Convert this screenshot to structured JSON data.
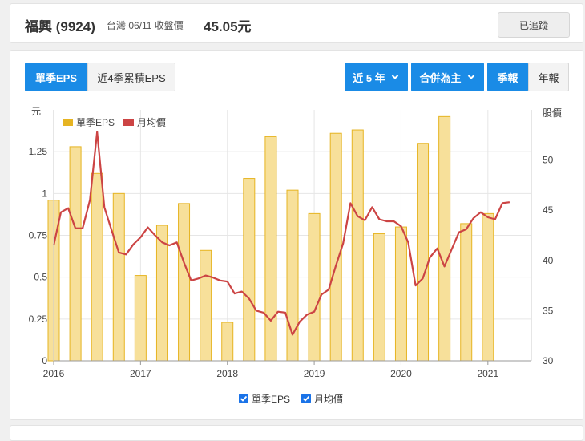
{
  "header": {
    "stock_name": "福興 (9924)",
    "quote_info": "台灣 06/11 收盤價",
    "price": "45.05元",
    "tracked_label": "已追蹤"
  },
  "toolbar": {
    "tab_quarter_eps": "單季EPS",
    "tab_cum4_eps": "近4季累積EPS",
    "range_label": "近 5 年",
    "consolidation_label": "合併為主",
    "quarterly_label": "季報",
    "annual_label": "年報"
  },
  "legend": {
    "eps_label": "單季EPS",
    "price_label": "月均價"
  },
  "colors": {
    "accent": "#1a8be6",
    "bar_fill": "#f7e09a",
    "bar_stroke": "#e6b422",
    "line": "#cc4444",
    "grid": "#e6e6e6"
  },
  "chart_data": {
    "type": "bar",
    "y_left_label": "元",
    "y_right_label": "股價",
    "y_left_range": [
      0,
      1.5
    ],
    "y_left_ticks": [
      "0",
      "0.25",
      "0.5",
      "0.75",
      "1",
      "1.25"
    ],
    "y_right_range": [
      30,
      55
    ],
    "y_right_ticks": [
      "30",
      "35",
      "40",
      "45",
      "50"
    ],
    "x_range": [
      2016.0,
      2021.5
    ],
    "x_ticks": [
      "2016",
      "2017",
      "2018",
      "2019",
      "2020",
      "2021"
    ],
    "grid": true,
    "legend_position": "top-left",
    "series": [
      {
        "name": "單季EPS",
        "type": "bar",
        "quarters": [
          "2016Q1",
          "2016Q2",
          "2016Q3",
          "2016Q4",
          "2017Q1",
          "2017Q2",
          "2017Q3",
          "2017Q4",
          "2018Q1",
          "2018Q2",
          "2018Q3",
          "2018Q4",
          "2019Q1",
          "2019Q2",
          "2019Q3",
          "2019Q4",
          "2020Q1",
          "2020Q2",
          "2020Q3",
          "2020Q4",
          "2021Q1"
        ],
        "x": [
          2016.0,
          2016.25,
          2016.5,
          2016.75,
          2017.0,
          2017.25,
          2017.5,
          2017.75,
          2018.0,
          2018.25,
          2018.5,
          2018.75,
          2019.0,
          2019.25,
          2019.5,
          2019.75,
          2020.0,
          2020.25,
          2020.5,
          2020.75,
          2021.0
        ],
        "values": [
          0.96,
          1.28,
          1.12,
          1.0,
          0.51,
          0.81,
          0.94,
          0.66,
          0.23,
          1.09,
          1.34,
          1.02,
          0.88,
          1.36,
          1.38,
          0.76,
          0.8,
          1.3,
          1.46,
          0.82,
          0.88
        ]
      },
      {
        "name": "月均價",
        "type": "line",
        "x": [
          2016.0,
          2016.083,
          2016.167,
          2016.25,
          2016.333,
          2016.417,
          2016.5,
          2016.583,
          2016.667,
          2016.75,
          2016.833,
          2016.917,
          2017.0,
          2017.083,
          2017.167,
          2017.25,
          2017.333,
          2017.417,
          2017.5,
          2017.583,
          2017.667,
          2017.75,
          2017.833,
          2017.917,
          2018.0,
          2018.083,
          2018.167,
          2018.25,
          2018.333,
          2018.417,
          2018.5,
          2018.583,
          2018.667,
          2018.75,
          2018.833,
          2018.917,
          2019.0,
          2019.083,
          2019.167,
          2019.25,
          2019.333,
          2019.417,
          2019.5,
          2019.583,
          2019.667,
          2019.75,
          2019.833,
          2019.917,
          2020.0,
          2020.083,
          2020.167,
          2020.25,
          2020.333,
          2020.417,
          2020.5,
          2020.583,
          2020.667,
          2020.75,
          2020.833,
          2020.917,
          2021.0,
          2021.083,
          2021.167,
          2021.25
        ],
        "values": [
          41.5,
          44.8,
          45.2,
          43.2,
          43.2,
          46.0,
          52.8,
          45.3,
          43.0,
          40.8,
          40.6,
          41.6,
          42.3,
          43.3,
          42.5,
          41.8,
          41.5,
          41.8,
          39.8,
          38.0,
          38.2,
          38.5,
          38.3,
          38.0,
          37.9,
          36.7,
          36.9,
          36.2,
          35.0,
          34.8,
          34.0,
          34.9,
          34.8,
          32.6,
          33.9,
          34.6,
          34.9,
          36.6,
          37.1,
          39.5,
          41.7,
          45.7,
          44.4,
          44.0,
          45.3,
          44.1,
          43.9,
          43.9,
          43.4,
          41.8,
          37.5,
          38.2,
          40.3,
          41.2,
          39.4,
          41.1,
          42.8,
          43.1,
          44.2,
          44.8,
          44.3,
          44.1,
          45.7,
          45.8
        ]
      }
    ]
  }
}
